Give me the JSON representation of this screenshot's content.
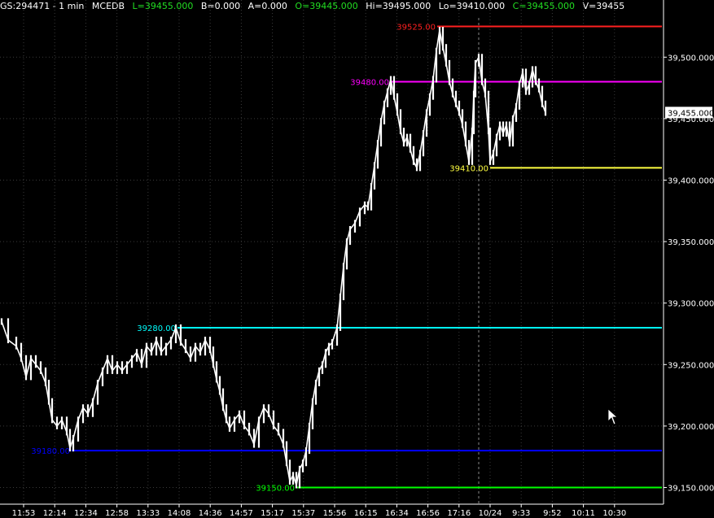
{
  "header": {
    "symbol": "GS:294471 - 1 min",
    "exchange": "MCEDB",
    "last": "L=39455.000",
    "bid": "B=0.000",
    "ask": "A=0.000",
    "open": "O=39445.000",
    "high": "Hi=39495.000",
    "low": "Lo=39410.000",
    "close": "C=39455.000",
    "volume": "V=39455"
  },
  "colors": {
    "background": "#000000",
    "price_line": "#ffffff",
    "axis": "#ffffff",
    "grid": "#3a3a3a",
    "level_39525": "#ff2020",
    "level_39480": "#ff00ff",
    "level_39410": "#ffff40",
    "level_39280": "#00ffff",
    "level_39180": "#0000ff",
    "level_39150": "#00ff00"
  },
  "chart_data": {
    "type": "line",
    "ylim": [
      39130,
      39530
    ],
    "y_ticks": [
      "39,150.000",
      "39,200.000",
      "39,250.000",
      "39,300.000",
      "39,350.000",
      "39,400.000",
      "39,450.000",
      "39,500.000"
    ],
    "y_tick_values": [
      39150,
      39200,
      39250,
      39300,
      39350,
      39400,
      39450,
      39500
    ],
    "last_price_label": "39,455.000",
    "last_price": 39455,
    "x_ticks": [
      "11:53",
      "12:14",
      "12:34",
      "12:58",
      "13:33",
      "14:08",
      "14:36",
      "14:57",
      "15:17",
      "15:37",
      "15:56",
      "16:15",
      "16:34",
      "16:56",
      "17:16",
      "10/24",
      "9:33",
      "9:52",
      "10:11",
      "10:30"
    ],
    "levels": [
      {
        "label": "39525.00",
        "value": 39525,
        "color": "#ff2020",
        "start_bar": 537
      },
      {
        "label": "39480.00",
        "value": 39480,
        "color": "#ff00ff",
        "start_bar": 480
      },
      {
        "label": "39410.00",
        "value": 39410,
        "color": "#ffff40",
        "start_bar": 602
      },
      {
        "label": "39280.00",
        "value": 39280,
        "color": "#00ffff",
        "start_bar": 218
      },
      {
        "label": "39180.00",
        "value": 39180,
        "color": "#0000ff",
        "start_bar": 88
      },
      {
        "label": "39150.00",
        "value": 39150,
        "color": "#00ff00",
        "start_bar": 364
      }
    ],
    "session_break_label": "10/24",
    "series": [
      {
        "points": [
          [
            2,
            39285
          ],
          [
            10,
            39270
          ],
          [
            20,
            39265
          ],
          [
            26,
            39255
          ],
          [
            32,
            39240
          ],
          [
            38,
            39255
          ],
          [
            44,
            39250
          ],
          [
            50,
            39245
          ],
          [
            56,
            39235
          ],
          [
            60,
            39220
          ],
          [
            64,
            39205
          ],
          [
            70,
            39200
          ],
          [
            76,
            39205
          ],
          [
            82,
            39195
          ],
          [
            86,
            39182
          ],
          [
            90,
            39190
          ],
          [
            96,
            39205
          ],
          [
            102,
            39215
          ],
          [
            108,
            39210
          ],
          [
            114,
            39220
          ],
          [
            120,
            39235
          ],
          [
            126,
            39245
          ],
          [
            132,
            39255
          ],
          [
            138,
            39245
          ],
          [
            144,
            39250
          ],
          [
            150,
            39245
          ],
          [
            156,
            39250
          ],
          [
            162,
            39255
          ],
          [
            168,
            39260
          ],
          [
            174,
            39250
          ],
          [
            180,
            39265
          ],
          [
            186,
            39260
          ],
          [
            192,
            39270
          ],
          [
            198,
            39260
          ],
          [
            204,
            39265
          ],
          [
            210,
            39270
          ],
          [
            216,
            39280
          ],
          [
            222,
            39268
          ],
          [
            228,
            39262
          ],
          [
            234,
            39255
          ],
          [
            240,
            39265
          ],
          [
            246,
            39260
          ],
          [
            252,
            39270
          ],
          [
            258,
            39262
          ],
          [
            262,
            39250
          ],
          [
            266,
            39238
          ],
          [
            270,
            39228
          ],
          [
            274,
            39215
          ],
          [
            278,
            39205
          ],
          [
            282,
            39198
          ],
          [
            288,
            39205
          ],
          [
            294,
            39210
          ],
          [
            300,
            39200
          ],
          [
            306,
            39195
          ],
          [
            312,
            39185
          ],
          [
            318,
            39205
          ],
          [
            324,
            39215
          ],
          [
            330,
            39210
          ],
          [
            336,
            39200
          ],
          [
            342,
            39195
          ],
          [
            348,
            39185
          ],
          [
            352,
            39170
          ],
          [
            356,
            39155
          ],
          [
            360,
            39160
          ],
          [
            364,
            39152
          ],
          [
            368,
            39165
          ],
          [
            372,
            39170
          ],
          [
            376,
            39180
          ],
          [
            380,
            39200
          ],
          [
            384,
            39220
          ],
          [
            388,
            39235
          ],
          [
            392,
            39245
          ],
          [
            396,
            39250
          ],
          [
            400,
            39260
          ],
          [
            404,
            39265
          ],
          [
            408,
            39268
          ],
          [
            414,
            39280
          ],
          [
            418,
            39305
          ],
          [
            422,
            39330
          ],
          [
            426,
            39350
          ],
          [
            430,
            39360
          ],
          [
            436,
            39365
          ],
          [
            442,
            39375
          ],
          [
            448,
            39380
          ],
          [
            452,
            39378
          ],
          [
            456,
            39395
          ],
          [
            460,
            39412
          ],
          [
            464,
            39430
          ],
          [
            468,
            39448
          ],
          [
            472,
            39462
          ],
          [
            476,
            39472
          ],
          [
            480,
            39482
          ],
          [
            484,
            39468
          ],
          [
            488,
            39455
          ],
          [
            492,
            39440
          ],
          [
            496,
            39430
          ],
          [
            500,
            39435
          ],
          [
            504,
            39425
          ],
          [
            508,
            39415
          ],
          [
            512,
            39410
          ],
          [
            516,
            39422
          ],
          [
            520,
            39438
          ],
          [
            524,
            39455
          ],
          [
            528,
            39468
          ],
          [
            532,
            39482
          ],
          [
            536,
            39505
          ],
          [
            540,
            39522
          ],
          [
            544,
            39508
          ],
          [
            548,
            39495
          ],
          [
            552,
            39480
          ],
          [
            556,
            39470
          ],
          [
            560,
            39462
          ],
          [
            564,
            39455
          ],
          [
            568,
            39445
          ],
          [
            572,
            39430
          ],
          [
            576,
            39415
          ],
          [
            580,
            39440
          ],
          [
            582,
            39470
          ],
          [
            584,
            39495
          ],
          [
            588,
            39500
          ],
          [
            592,
            39480
          ],
          [
            596,
            39470
          ],
          [
            600,
            39440
          ],
          [
            602,
            39415
          ],
          [
            606,
            39422
          ],
          [
            610,
            39435
          ],
          [
            614,
            39445
          ],
          [
            618,
            39438
          ],
          [
            622,
            39445
          ],
          [
            626,
            39430
          ],
          [
            630,
            39450
          ],
          [
            634,
            39460
          ],
          [
            638,
            39478
          ],
          [
            642,
            39488
          ],
          [
            646,
            39472
          ],
          [
            650,
            39478
          ],
          [
            654,
            39490
          ],
          [
            658,
            39480
          ],
          [
            662,
            39474
          ],
          [
            666,
            39462
          ],
          [
            670,
            39455
          ]
        ]
      }
    ]
  }
}
